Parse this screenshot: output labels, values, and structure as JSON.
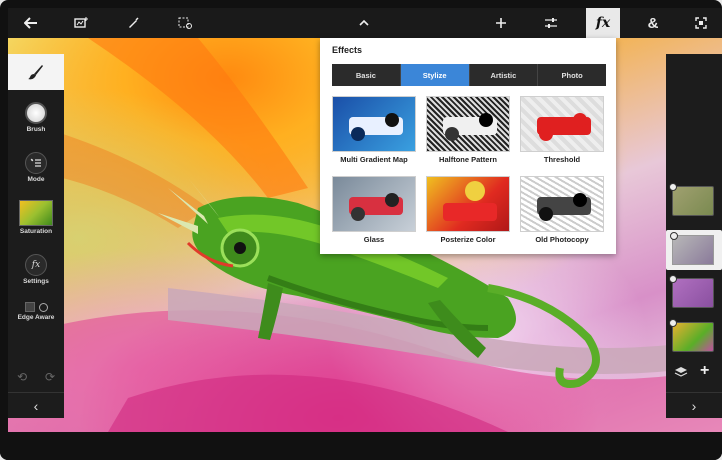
{
  "toolbar": {
    "back_icon": "arrow-left-icon",
    "image_icon": "image-plus-icon",
    "pen_icon": "pen-icon",
    "select_icon": "selection-icon",
    "collapse_icon": "chevron-up-icon",
    "add_icon": "plus-icon",
    "adjust_icon": "sliders-icon",
    "fx_label": "fx",
    "blend_label": "&",
    "fullscreen_icon": "fullscreen-icon"
  },
  "left_panel": {
    "brush_label": "Brush",
    "mode_label": "Mode",
    "saturation_label": "Saturation",
    "settings_label": "Settings",
    "edge_aware_label": "Edge Aware",
    "collapse_label": "‹"
  },
  "right_panel": {
    "add_layer_label": "+",
    "collapse_label": "›"
  },
  "effects": {
    "title": "Effects",
    "tabs": [
      "Basic",
      "Stylize",
      "Artistic",
      "Photo"
    ],
    "selected_tab": "Stylize",
    "items": [
      {
        "label": "Multi Gradient Map"
      },
      {
        "label": "Halftone Pattern"
      },
      {
        "label": "Threshold"
      },
      {
        "label": "Glass"
      },
      {
        "label": "Posterize Color"
      },
      {
        "label": "Old Photocopy"
      }
    ]
  },
  "colors": {
    "toolbar_bg": "#1a1a1a",
    "accent_tab": "#3b86d8",
    "panel_bg": "#1c1c1c"
  }
}
